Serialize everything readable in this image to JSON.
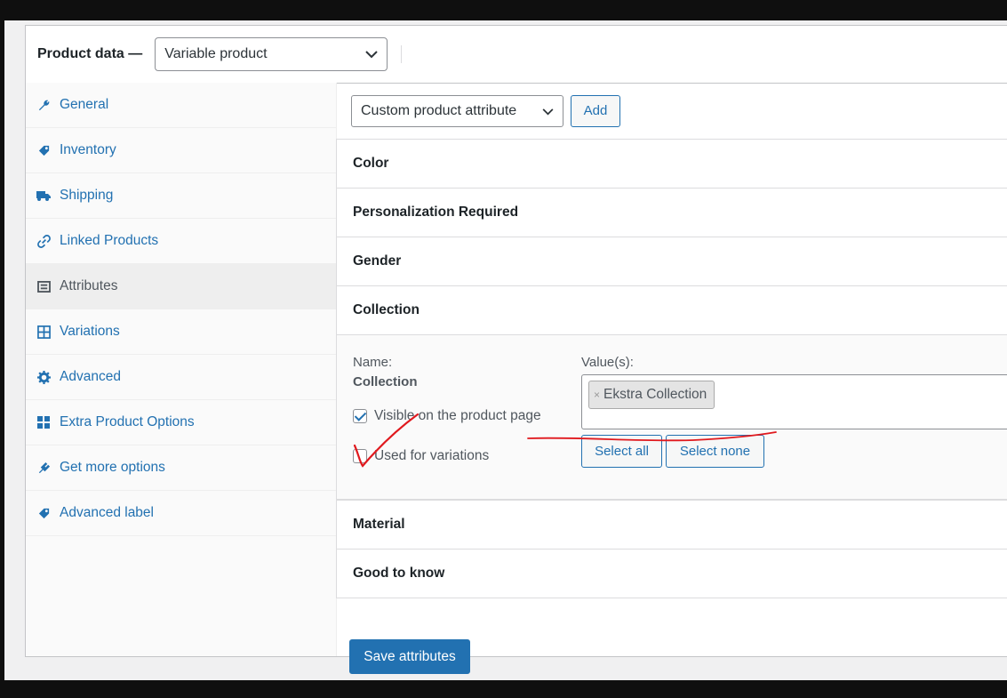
{
  "header": {
    "title": "Product data —",
    "product_type": "Variable product"
  },
  "sidebar": {
    "items": [
      {
        "label": "General",
        "icon": "wrench-icon"
      },
      {
        "label": "Inventory",
        "icon": "tag-icon"
      },
      {
        "label": "Shipping",
        "icon": "truck-icon"
      },
      {
        "label": "Linked Products",
        "icon": "link-icon"
      },
      {
        "label": "Attributes",
        "icon": "list-icon",
        "active": true
      },
      {
        "label": "Variations",
        "icon": "grid-icon"
      },
      {
        "label": "Advanced",
        "icon": "gear-icon"
      },
      {
        "label": "Extra Product Options",
        "icon": "blocks-icon"
      },
      {
        "label": "Get more options",
        "icon": "plugin-icon"
      },
      {
        "label": "Advanced label",
        "icon": "label-icon"
      }
    ]
  },
  "toolbar": {
    "attribute_select": "Custom product attribute",
    "add_label": "Add"
  },
  "attributes": {
    "color": "Color",
    "personalization": "Personalization Required",
    "gender": "Gender",
    "collection": "Collection",
    "material": "Material",
    "good_to_know": "Good to know"
  },
  "collection_panel": {
    "name_label": "Name:",
    "name_value": "Collection",
    "values_label": "Value(s):",
    "token": "Ekstra Collection",
    "token_remove": "×",
    "visible_label": "Visible on the product page",
    "visible_checked": true,
    "variations_label": "Used for variations",
    "variations_checked": false,
    "select_all": "Select all",
    "select_none": "Select none"
  },
  "save_label": "Save attributes",
  "colors": {
    "accent": "#2271b1",
    "annotation": "#e0191e"
  }
}
